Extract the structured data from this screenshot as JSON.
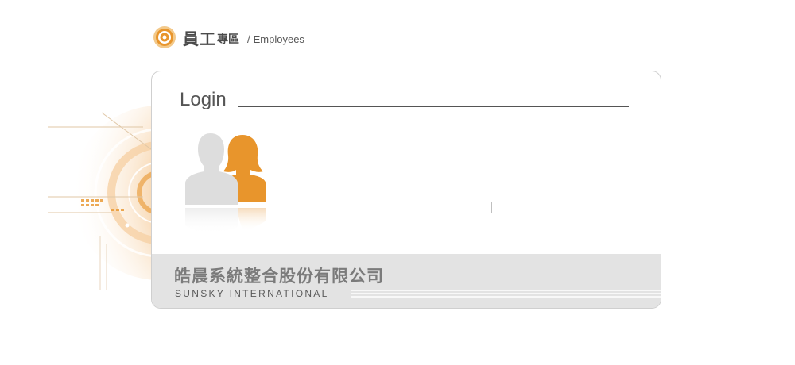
{
  "header": {
    "title_main": "員工",
    "title_sub_cn": "專區",
    "separator": "/",
    "title_en": "Employees",
    "logo_icon": "target-ring-icon"
  },
  "login": {
    "heading": "Login",
    "users_icon": "users-silhouette-icon"
  },
  "footer": {
    "company_cn": "皓晨系統整合股份有限公司",
    "company_en": "SUNSKY INTERNATIONAL"
  },
  "colors": {
    "accent_orange": "#e8952c",
    "silhouette_gray": "#d9d9d9",
    "footer_band": "#e3e3e3",
    "text_dark": "#4a4a4a"
  }
}
